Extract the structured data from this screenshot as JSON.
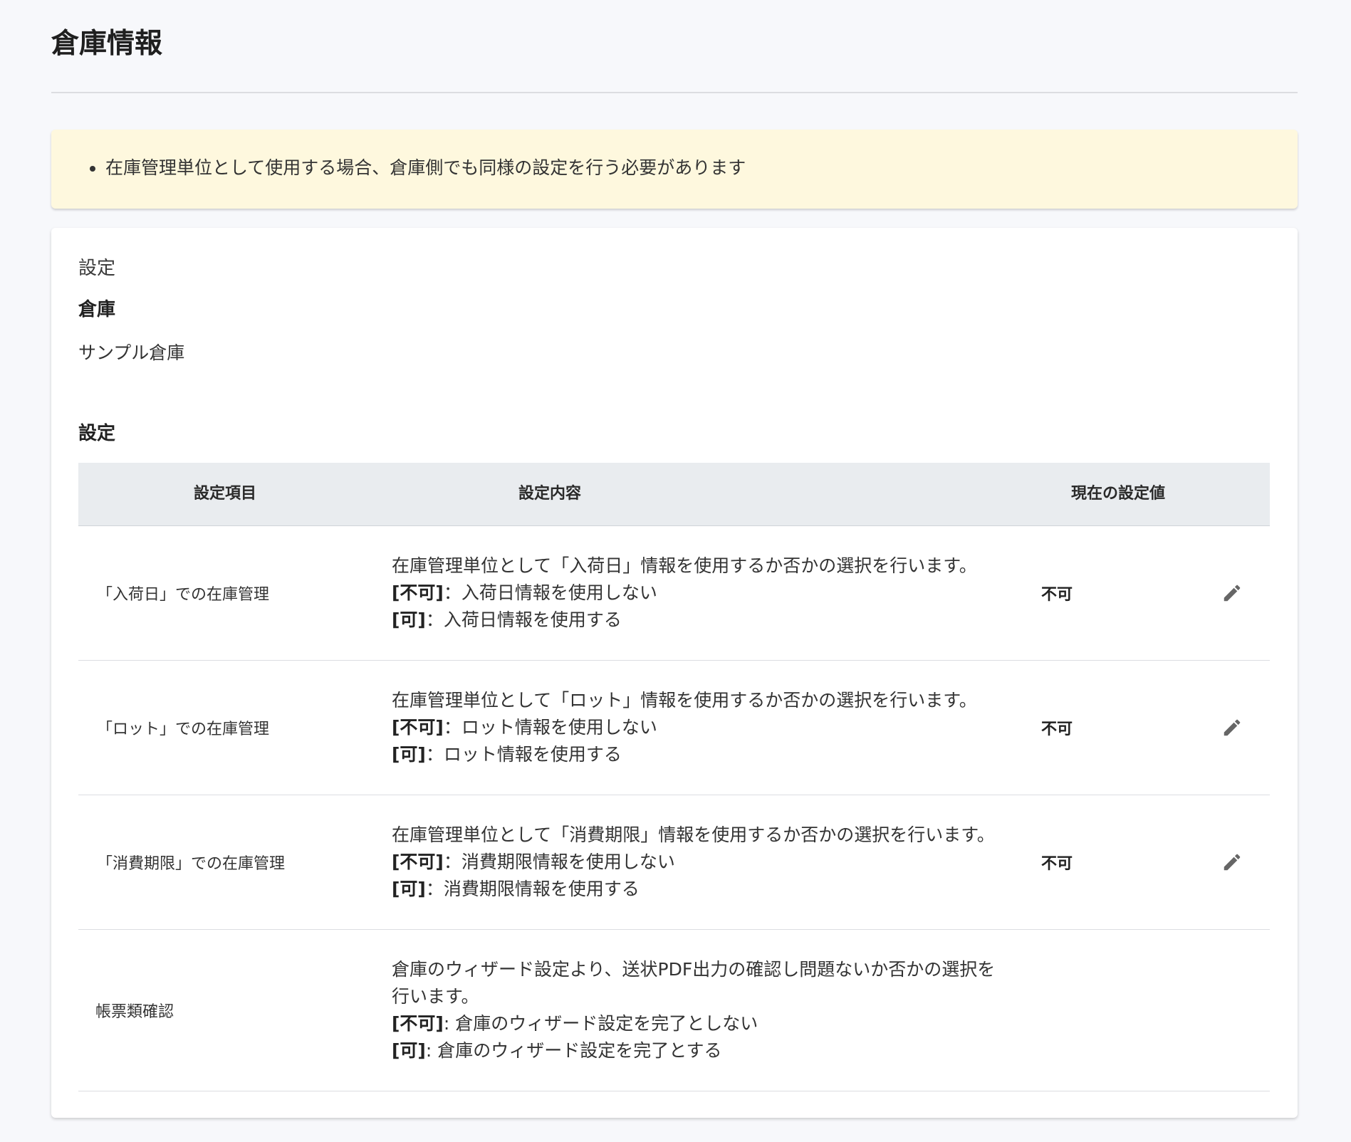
{
  "page": {
    "title": "倉庫情報"
  },
  "notice": {
    "items": [
      "在庫管理単位として使用する場合、倉庫側でも同様の設定を行う必要があります"
    ]
  },
  "card": {
    "heading": "設定",
    "warehouse_label": "倉庫",
    "warehouse_value": "サンプル倉庫",
    "settings_title": "設定"
  },
  "table": {
    "headers": {
      "item": "設定項目",
      "description": "設定内容",
      "current_value": "現在の設定値"
    },
    "rows": [
      {
        "item": "「入荷日」での在庫管理",
        "description": {
          "intro": "在庫管理単位として「入荷日」情報を使用するか否かの選択を行います。",
          "no_tag": "[不可]",
          "no_text": "：入荷日情報を使用しない",
          "yes_tag": "[可]",
          "yes_text": "：入荷日情報を使用する"
        },
        "value": "不可",
        "edit_icon": "pencil-icon"
      },
      {
        "item": "「ロット」での在庫管理",
        "description": {
          "intro": "在庫管理単位として「ロット」情報を使用するか否かの選択を行います。",
          "no_tag": "[不可]",
          "no_text": "：ロット情報を使用しない",
          "yes_tag": "[可]",
          "yes_text": "：ロット情報を使用する"
        },
        "value": "不可",
        "edit_icon": "pencil-icon"
      },
      {
        "item": "「消費期限」での在庫管理",
        "description": {
          "intro": "在庫管理単位として「消費期限」情報を使用するか否かの選択を行います。",
          "no_tag": "[不可]",
          "no_text": "：消費期限情報を使用しない",
          "yes_tag": "[可]",
          "yes_text": "：消費期限情報を使用する"
        },
        "value": "不可",
        "edit_icon": "pencil-icon"
      },
      {
        "item": "帳票類確認",
        "description": {
          "intro_line1": "倉庫のウィザード設定より、送状PDF出力の確認し問題ないか否かの選択を",
          "intro_line2": "行います。",
          "no_tag": "[不可]",
          "no_text": ": 倉庫のウィザード設定を完了としない",
          "yes_tag": "[可]",
          "yes_text": ": 倉庫のウィザード設定を完了とする"
        }
      }
    ]
  },
  "colors": {
    "background": "#f7f8fb",
    "notice_bg": "#fef8de",
    "table_header_bg": "#e9ecef",
    "icon": "#666666"
  }
}
